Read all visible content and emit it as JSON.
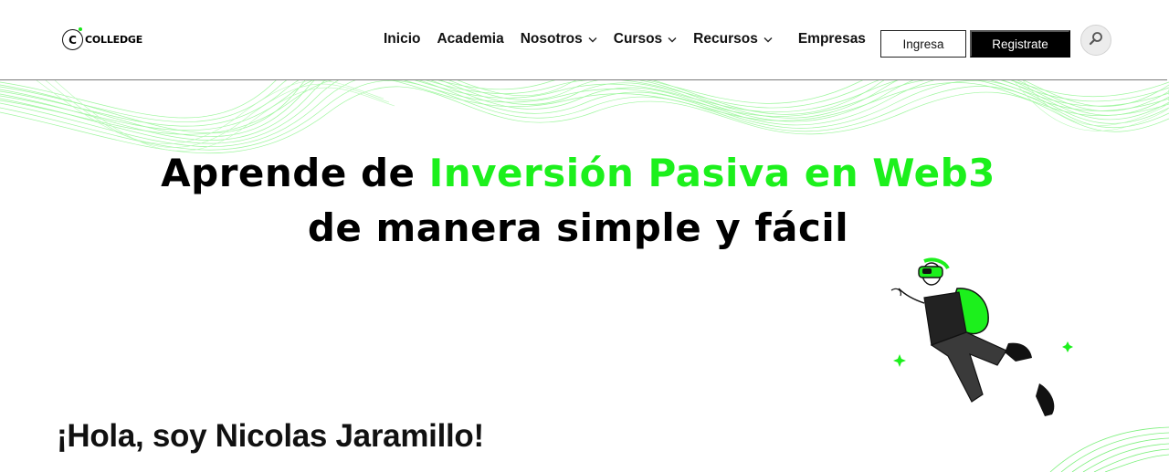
{
  "header": {
    "logo_text": "COLLEDGE",
    "logo_mark": "C"
  },
  "nav": {
    "items": [
      {
        "label": "Inicio",
        "has_dropdown": false
      },
      {
        "label": "Academia",
        "has_dropdown": false
      },
      {
        "label": "Nosotros",
        "has_dropdown": true
      },
      {
        "label": "Cursos",
        "has_dropdown": true
      },
      {
        "label": "Recursos",
        "has_dropdown": true
      },
      {
        "label": "Empresas",
        "has_dropdown": false
      }
    ]
  },
  "actions": {
    "login_label": "Ingresa",
    "register_label": "Registrate",
    "search_icon": "search-icon"
  },
  "hero": {
    "title_prefix": "Aprende de ",
    "title_highlight": "Inversión Pasiva en Web3",
    "title_line2": "de manera simple y fácil"
  },
  "intro": {
    "heading": "¡Hola, soy Nicolas Jaramillo!"
  },
  "colors": {
    "accent_green": "#1cf01c",
    "text": "#000000",
    "button_dark": "#000000"
  }
}
